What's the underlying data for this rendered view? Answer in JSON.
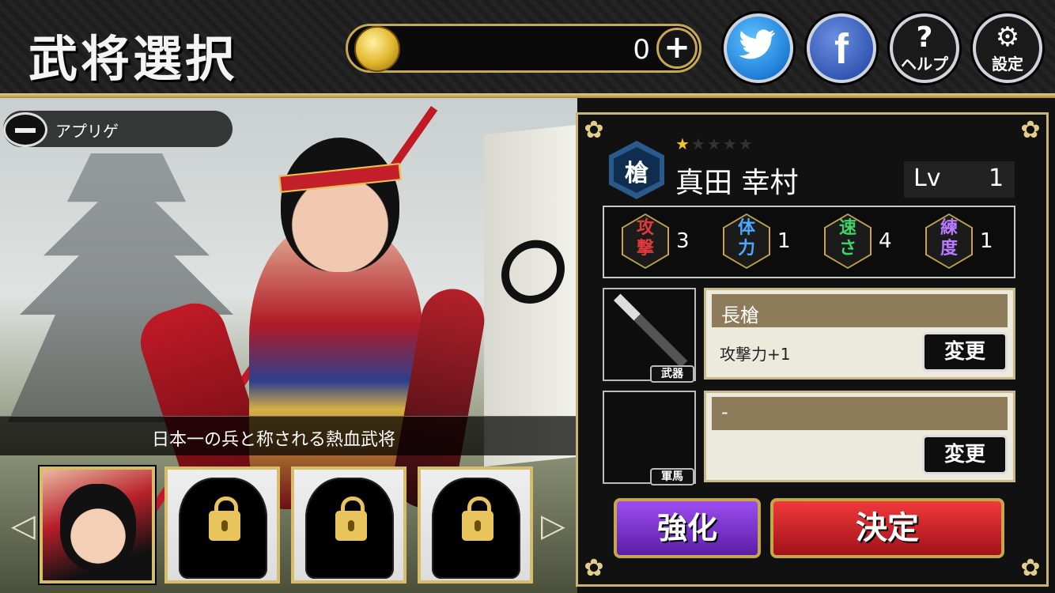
{
  "header": {
    "title": "武将選択",
    "coin_count": "0",
    "plus_label": "+",
    "buttons": {
      "twitter_icon": "twitter-icon",
      "facebook_glyph": "f",
      "help_glyph": "?",
      "help_label": "ヘルプ",
      "settings_glyph": "⚙",
      "settings_label": "設定"
    }
  },
  "scene": {
    "favorite_label": "アプリゲ",
    "description": "日本一の兵と称される熱血武将"
  },
  "roster": {
    "characters": [
      {
        "state": "selected"
      },
      {
        "state": "locked"
      },
      {
        "state": "locked"
      },
      {
        "state": "locked"
      }
    ],
    "prev_arrow": "◁",
    "next_arrow": "▷"
  },
  "general": {
    "class": "槍",
    "rarity": 1,
    "rarity_max": 5,
    "name": "真田 幸村",
    "level_label": "Lv",
    "level": "1",
    "stats": [
      {
        "name_top": "攻",
        "name_bottom": "撃",
        "value": "3",
        "color": "#e23a3a"
      },
      {
        "name_top": "体",
        "name_bottom": "力",
        "value": "1",
        "color": "#4aa8ff"
      },
      {
        "name_top": "速",
        "name_bottom": "さ",
        "value": "4",
        "color": "#3fd46a"
      },
      {
        "name_top": "練",
        "name_bottom": "度",
        "value": "1",
        "color": "#b67bff"
      }
    ]
  },
  "equipment": {
    "weapon": {
      "tag": "武器",
      "name": "長槍",
      "effect": "攻撃力+1",
      "change_label": "変更"
    },
    "horse": {
      "tag": "軍馬",
      "name": "-",
      "effect": "",
      "change_label": "変更"
    }
  },
  "actions": {
    "enhance_label": "強化",
    "decide_label": "決定"
  },
  "colors": {
    "gold_frame": "#c9b473",
    "enhance": "#7a34cf",
    "decide": "#d72530"
  }
}
